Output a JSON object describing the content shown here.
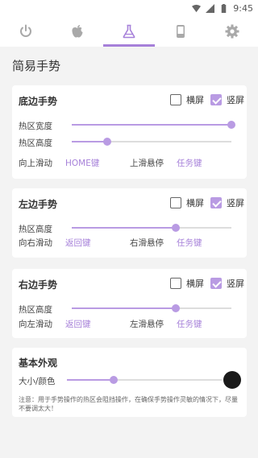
{
  "statusbar": {
    "time": "9:45"
  },
  "tabs": [
    {
      "name": "power-icon"
    },
    {
      "name": "apple-icon"
    },
    {
      "name": "flask-icon",
      "active": true
    },
    {
      "name": "phone-icon"
    },
    {
      "name": "gear-icon"
    }
  ],
  "colors": {
    "accent": "#a680d9",
    "check": "#b99be3",
    "track": "#dddddd",
    "dot": "#1a1a1a"
  },
  "page_title": "简易手势",
  "bottom": {
    "title": "底边手势",
    "landscape_label": "横屏",
    "landscape_checked": false,
    "portrait_label": "竖屏",
    "portrait_checked": true,
    "width_label": "热区宽度",
    "width_value": 1.0,
    "height_label": "热区高度",
    "height_value": 0.22,
    "action1_label": "向上滑动",
    "action1_value": "HOME键",
    "action2_label": "上滑悬停",
    "action2_value": "任务键"
  },
  "left": {
    "title": "左边手势",
    "landscape_label": "横屏",
    "landscape_checked": false,
    "portrait_label": "竖屏",
    "portrait_checked": true,
    "height_label": "热区高度",
    "height_value": 0.65,
    "action1_label": "向右滑动",
    "action1_value": "返回键",
    "action2_label": "右滑悬停",
    "action2_value": "任务键"
  },
  "right": {
    "title": "右边手势",
    "landscape_label": "横屏",
    "landscape_checked": false,
    "portrait_label": "竖屏",
    "portrait_checked": true,
    "height_label": "热区高度",
    "height_value": 0.65,
    "action1_label": "向左滑动",
    "action1_value": "返回键",
    "action2_label": "左滑悬停",
    "action2_value": "任务键"
  },
  "appearance": {
    "title": "基本外观",
    "size_color_label": "大小/颜色",
    "size_value": 0.3,
    "note": "注意：用于手势操作的热区会阻挡操作，在确保手势操作灵敏的情况下，尽量不要调太大！"
  }
}
